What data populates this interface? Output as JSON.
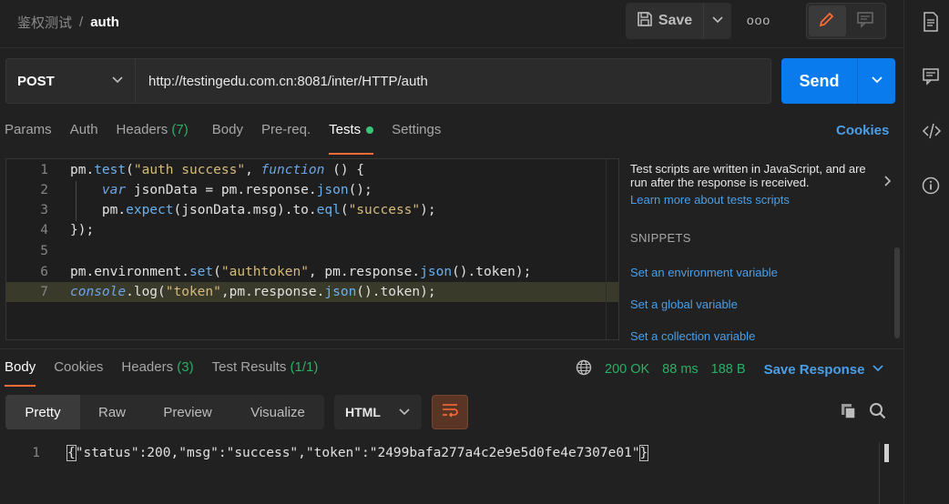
{
  "breadcrumb": {
    "collection": "鉴权测试",
    "separator": "/",
    "request": "auth"
  },
  "toolbar": {
    "save_label": "Save",
    "more_label": "ooo"
  },
  "request": {
    "method": "POST",
    "url": "http://testingedu.com.cn:8081/inter/HTTP/auth",
    "send_label": "Send"
  },
  "request_tabs": {
    "params": "Params",
    "auth": "Auth",
    "headers": "Headers",
    "headers_count": "(7)",
    "body": "Body",
    "prereq": "Pre-req.",
    "tests": "Tests",
    "settings": "Settings",
    "cookies": "Cookies"
  },
  "editor": {
    "lines": [
      {
        "n": "1"
      },
      {
        "n": "2"
      },
      {
        "n": "3"
      },
      {
        "n": "4"
      },
      {
        "n": "5"
      },
      {
        "n": "6"
      },
      {
        "n": "7"
      }
    ],
    "tokens": {
      "l1a": "pm.",
      "l1b": "test",
      "l1c": "(",
      "l1d": "\"auth success\"",
      "l1e": ", ",
      "l1f": "function",
      "l1g": " () {",
      "l2a": "    ",
      "l2b": "var",
      "l2c": " jsonData = pm.response.",
      "l2d": "json",
      "l2e": "();",
      "l3a": "    pm.",
      "l3b": "expect",
      "l3c": "(jsonData.msg).to.",
      "l3d": "eql",
      "l3e": "(",
      "l3f": "\"success\"",
      "l3g": ");",
      "l4a": "});",
      "l6a": "pm.environment.",
      "l6b": "set",
      "l6c": "(",
      "l6d": "\"authtoken\"",
      "l6e": ", pm.response.",
      "l6f": "json",
      "l6g": "().token);",
      "l7a": "console",
      "l7b": ".log(",
      "l7c": "\"token\"",
      "l7d": ",pm.response.",
      "l7e": "json",
      "l7f": "().token);"
    }
  },
  "snippets": {
    "info": "Test scripts are written in JavaScript, and are run after the response is received.",
    "learn_more": "Learn more about tests scripts",
    "heading": "SNIPPETS",
    "items": [
      "Set an environment variable",
      "Set a global variable",
      "Set a collection variable"
    ]
  },
  "response_tabs": {
    "body": "Body",
    "cookies": "Cookies",
    "headers": "Headers",
    "headers_count": "(3)",
    "test_results": "Test Results",
    "test_results_count": "(1/1)"
  },
  "response_meta": {
    "status": "200 OK",
    "time": "88 ms",
    "size": "188 B",
    "save_response": "Save Response"
  },
  "format_bar": {
    "pretty": "Pretty",
    "raw": "Raw",
    "preview": "Preview",
    "visualize": "Visualize",
    "language": "HTML"
  },
  "response_body": {
    "line_number": "1",
    "open": "{",
    "content": "\"status\":200,\"msg\":\"success\",\"token\":\"2499bafa277a4c2e9e5d0fe4e7307e01\"",
    "close": "}"
  },
  "colors": {
    "accent_orange": "#ff6c37",
    "send_blue": "#097bed",
    "link_blue": "#4a9fe8",
    "success_green": "#2cae67"
  }
}
